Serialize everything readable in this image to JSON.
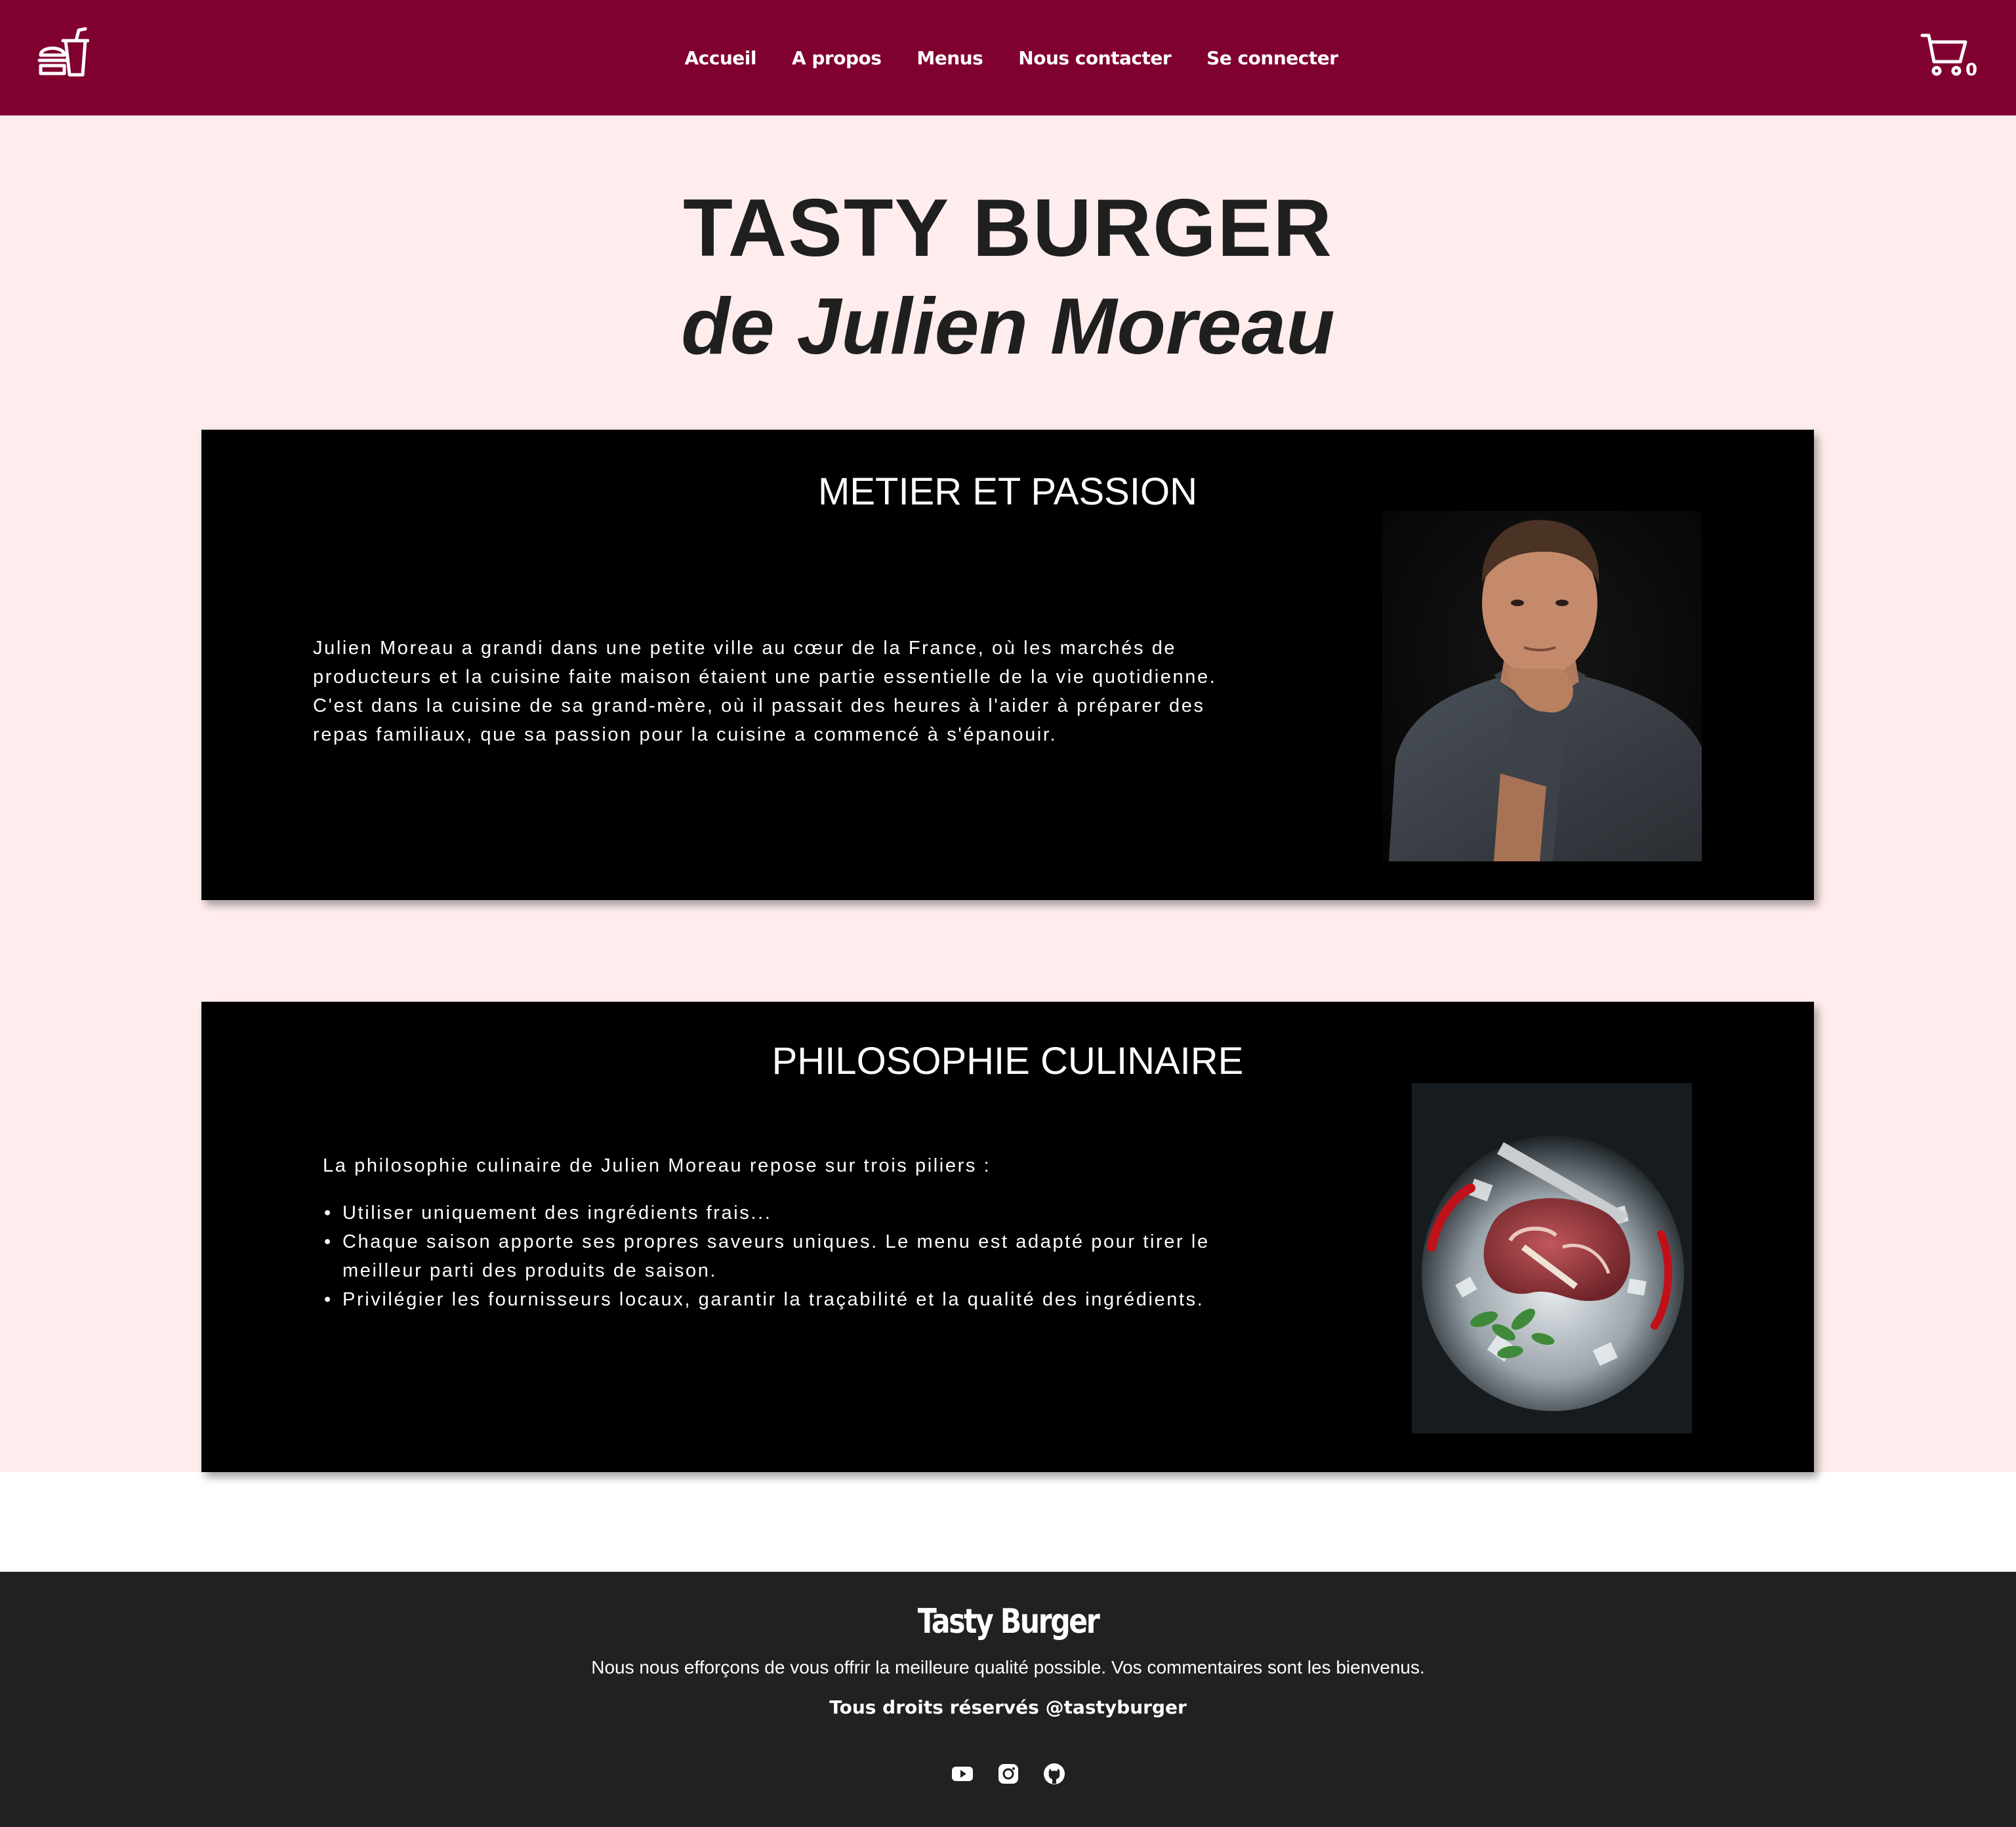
{
  "nav": {
    "logo_icon": "burger-drink-icon",
    "links": [
      "Accueil",
      "A propos",
      "Menus",
      "Nous contacter",
      "Se connecter"
    ],
    "cart_icon": "cart-icon",
    "cart_count": "0"
  },
  "hero": {
    "title": "TASTY BURGER",
    "subtitle": "de Julien Moreau"
  },
  "sections": [
    {
      "title": "METIER ET PASSION",
      "text": "Julien Moreau a grandi dans une petite ville au cœur de la France, où les marchés de producteurs et la cuisine faite maison étaient une partie essentielle de la vie quotidienne. C'est dans la cuisine de sa grand-mère, où il passait des heures à l'aider à préparer des repas familiaux, que sa passion pour la cuisine a commencé à s'épanouir.",
      "image": "chef-portrait"
    },
    {
      "title": "PHILOSOPHIE CULINAIRE",
      "intro": "La philosophie culinaire de Julien Moreau repose sur trois piliers :",
      "items": [
        "Utiliser uniquement des ingrédients frais...",
        "Chaque saison apporte ses propres saveurs uniques. Le menu est adapté pour tirer le meilleur parti des produits de saison.",
        "Privilégier les fournisseurs locaux, garantir la traçabilité et la qualité des ingrédients."
      ],
      "image": "steak-on-ice"
    }
  ],
  "footer": {
    "brand": "Tasty Burger",
    "tagline": "Nous nous efforçons de vous offrir la meilleure qualité possible. Vos commentaires sont les bienvenus.",
    "rights": "Tous droits réservés @tastyburger",
    "social_icons": [
      "youtube-icon",
      "instagram-icon",
      "github-icon"
    ]
  },
  "colors": {
    "nav_bg": "#800030",
    "main_bg": "#ffeded",
    "card_bg": "#000000",
    "footer_bg": "#212121",
    "title_text": "#1f1f1f"
  }
}
